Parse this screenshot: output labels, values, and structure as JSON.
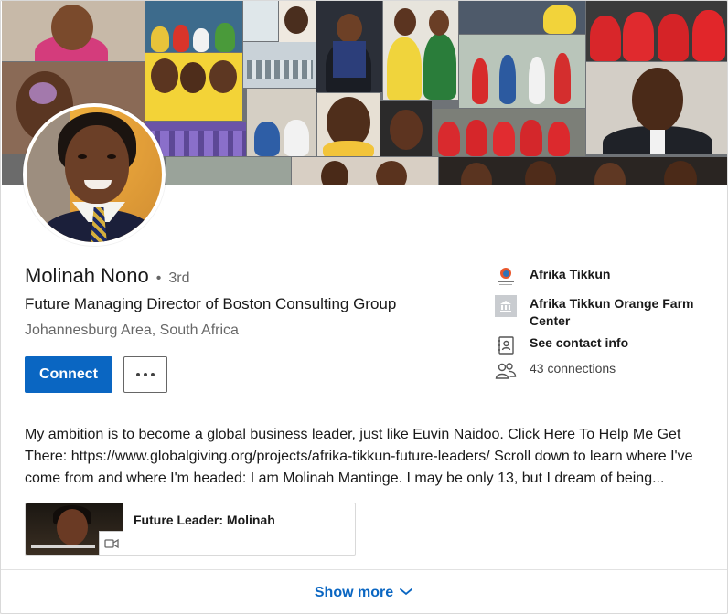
{
  "profile": {
    "name": "Molinah Nono",
    "separator": "•",
    "degree": "3rd",
    "headline": "Future Managing Director of Boston Consulting Group",
    "location": "Johannesburg Area, South Africa"
  },
  "actions": {
    "connect_label": "Connect",
    "more_icon": "ellipsis-icon"
  },
  "side": {
    "company": {
      "label": "Afrika Tikkun",
      "icon": "company-logo"
    },
    "school": {
      "label": "Afrika Tikkun Orange Farm Center",
      "icon": "school-building-icon"
    },
    "contact": {
      "label": "See contact info",
      "icon": "contact-card-icon"
    },
    "connections": {
      "label": "43 connections",
      "icon": "people-icon"
    }
  },
  "summary": {
    "text": "My ambition is to become a global business leader, just like Euvin Naidoo. Click Here To Help Me Get There: https://www.globalgiving.org/projects/afrika-tikkun-future-leaders/ Scroll down to learn where I've come from and where I'm headed: I am Molinah Mantinge. I may be only 13, but I dream of being..."
  },
  "media": {
    "title": "Future Leader: Molinah",
    "badge_icon": "video-icon"
  },
  "footer": {
    "show_more_label": "Show more",
    "chevron_icon": "chevron-down-icon"
  },
  "colors": {
    "primary": "#0a66c2",
    "text": "#191919",
    "muted": "#666666",
    "divider": "#d9d9d9"
  }
}
